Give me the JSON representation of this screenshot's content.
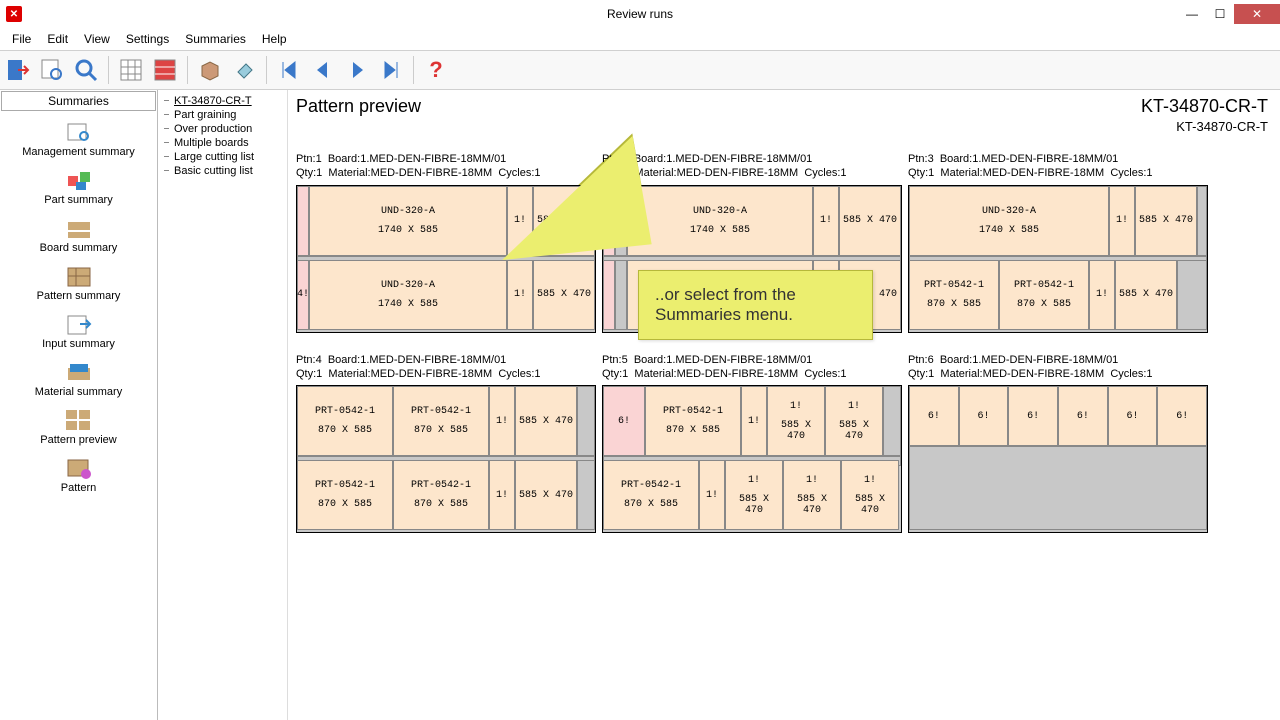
{
  "window": {
    "title": "Review runs"
  },
  "menu": [
    "File",
    "Edit",
    "View",
    "Settings",
    "Summaries",
    "Help"
  ],
  "sidebar": {
    "header": "Summaries",
    "items": [
      {
        "label": "Management summary"
      },
      {
        "label": "Part summary"
      },
      {
        "label": "Board summary"
      },
      {
        "label": "Pattern summary"
      },
      {
        "label": "Input summary"
      },
      {
        "label": "Material summary"
      },
      {
        "label": "Pattern preview"
      },
      {
        "label": "Pattern"
      }
    ]
  },
  "tree": [
    "KT-34870-CR-T",
    "Part graining",
    "Over production",
    "Multiple boards",
    "Large cutting list",
    "Basic cutting list"
  ],
  "preview": {
    "title": "Pattern preview",
    "code": "KT-34870-CR-T",
    "sub": "KT-34870-CR-T"
  },
  "callout": "..or select from the Summaries menu.",
  "patterns": [
    {
      "ptn": "Ptn:1",
      "board": "Board:1.MED-DEN-FIBRE-18MM/01",
      "qty": "Qty:1",
      "mat": "Material:MED-DEN-FIBRE-18MM",
      "cyc": "Cycles:1"
    },
    {
      "ptn": "Ptn:2",
      "board": "Board:1.MED-DEN-FIBRE-18MM/01",
      "qty": "Qty:1",
      "mat": "Material:MED-DEN-FIBRE-18MM",
      "cyc": "Cycles:1"
    },
    {
      "ptn": "Ptn:3",
      "board": "Board:1.MED-DEN-FIBRE-18MM/01",
      "qty": "Qty:1",
      "mat": "Material:MED-DEN-FIBRE-18MM",
      "cyc": "Cycles:1"
    },
    {
      "ptn": "Ptn:4",
      "board": "Board:1.MED-DEN-FIBRE-18MM/01",
      "qty": "Qty:1",
      "mat": "Material:MED-DEN-FIBRE-18MM",
      "cyc": "Cycles:1"
    },
    {
      "ptn": "Ptn:5",
      "board": "Board:1.MED-DEN-FIBRE-18MM/01",
      "qty": "Qty:1",
      "mat": "Material:MED-DEN-FIBRE-18MM",
      "cyc": "Cycles:1"
    },
    {
      "ptn": "Ptn:6",
      "board": "Board:1.MED-DEN-FIBRE-18MM/01",
      "qty": "Qty:1",
      "mat": "Material:MED-DEN-FIBRE-18MM",
      "cyc": "Cycles:1"
    }
  ],
  "parts": {
    "und": {
      "name": "UND-320-A",
      "size": "1740 X 585"
    },
    "prt": {
      "name": "PRT-0542-1",
      "size": "870 X 585"
    },
    "small": "585 X 470",
    "q1": "1!",
    "q4": "4!",
    "q6": "6!"
  }
}
